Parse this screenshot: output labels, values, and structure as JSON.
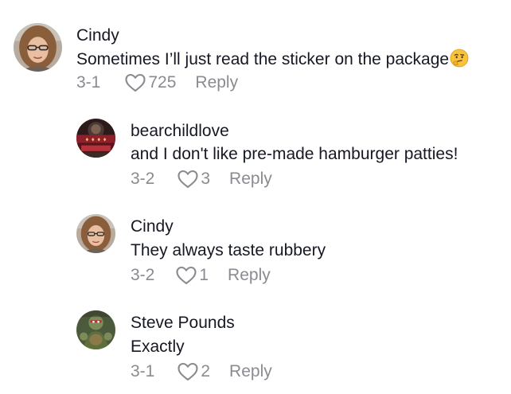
{
  "comments": [
    {
      "author": "Cindy",
      "text": "Sometimes I’ll just read the sticker on the package",
      "emoji": "thinking-face",
      "date": "3-1",
      "likes": "725",
      "reply_label": "Reply",
      "avatar": "avatar-cindy",
      "is_reply": false
    },
    {
      "author": "bearchildlove",
      "text": "and I don't like pre-made hamburger patties!",
      "date": "3-2",
      "likes": "3",
      "reply_label": "Reply",
      "avatar": "avatar-bearchildlove",
      "is_reply": true
    },
    {
      "author": "Cindy",
      "text": "They always taste rubbery",
      "date": "3-2",
      "likes": "1",
      "reply_label": "Reply",
      "avatar": "avatar-cindy",
      "is_reply": true
    },
    {
      "author": "Steve Pounds",
      "text": "Exactly",
      "date": "3-1",
      "likes": "2",
      "reply_label": "Reply",
      "avatar": "avatar-steve",
      "is_reply": true
    }
  ],
  "colors": {
    "text_primary": "#161823",
    "text_secondary": "#8a8b91",
    "background": "#ffffff"
  }
}
